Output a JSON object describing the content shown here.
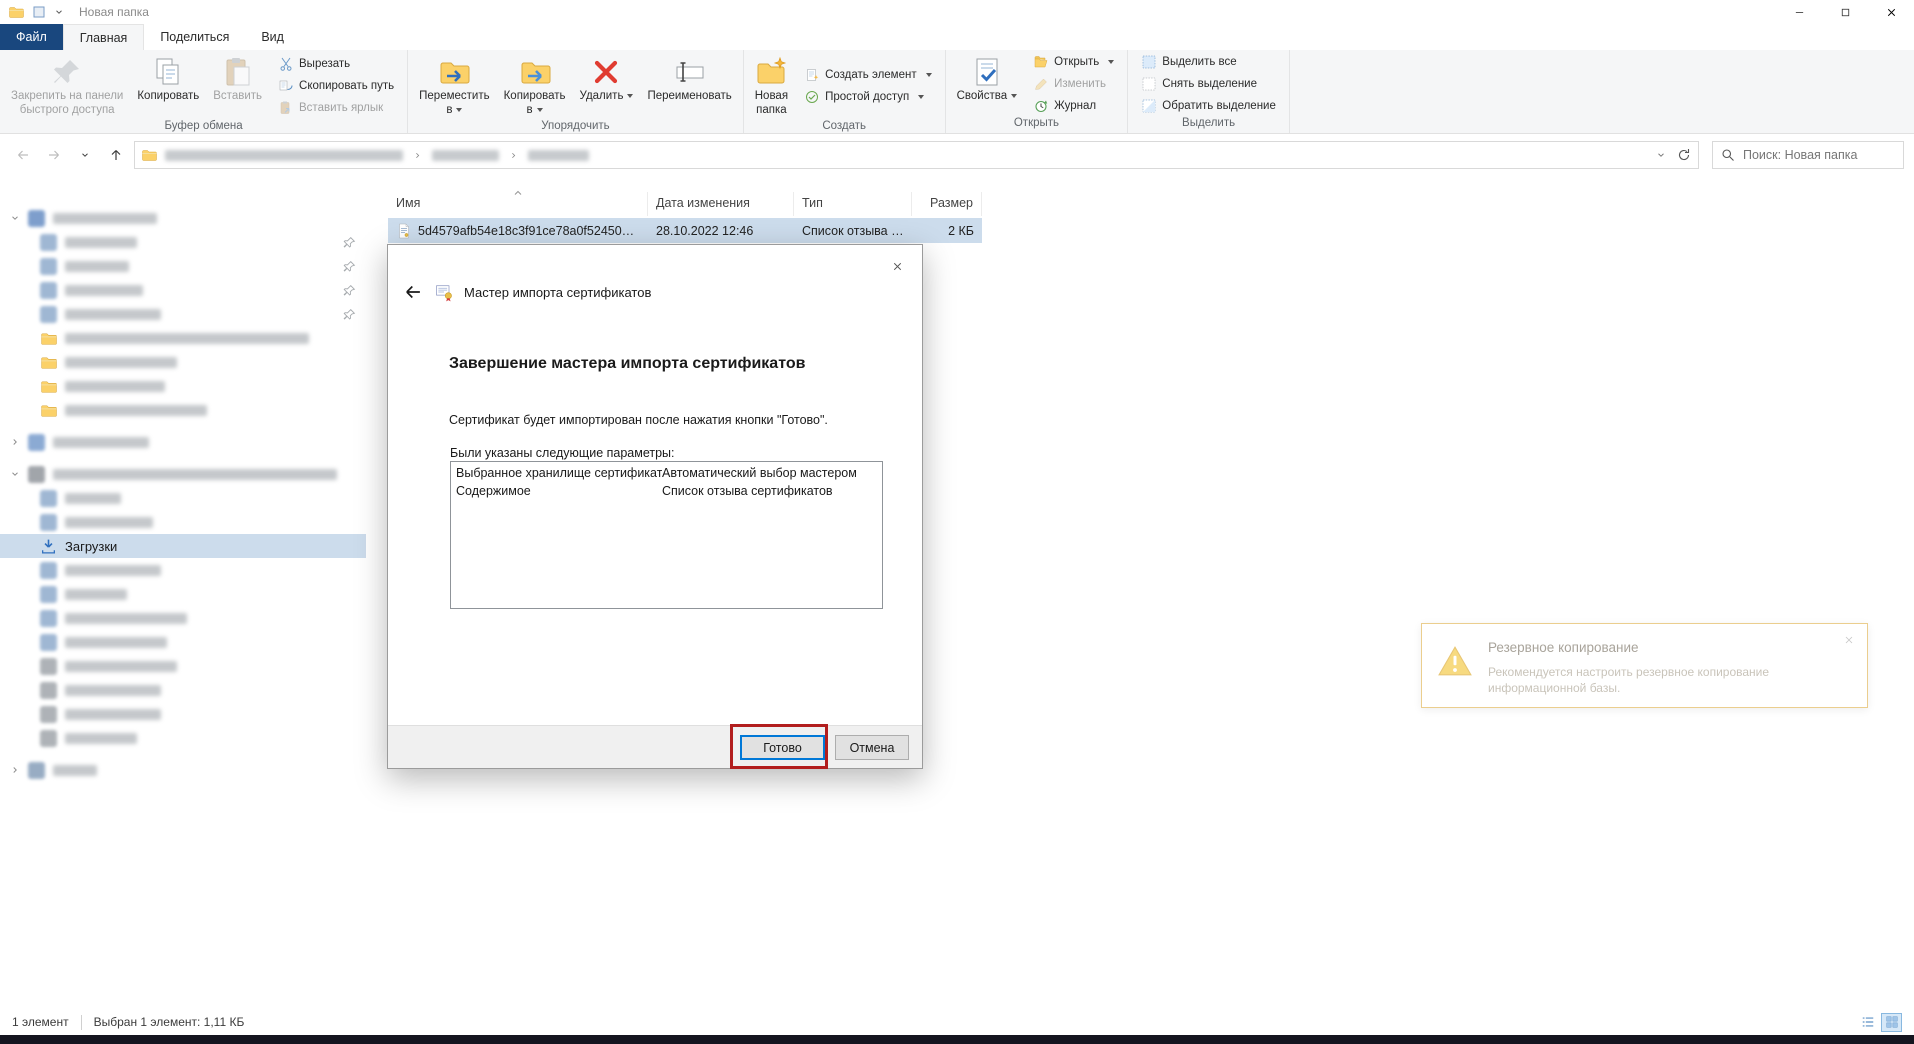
{
  "titlebar": {
    "title": "Новая папка"
  },
  "tabs": {
    "file_label": "Файл",
    "items": [
      {
        "label": "Главная",
        "selected": true
      },
      {
        "label": "Поделиться",
        "selected": false
      },
      {
        "label": "Вид",
        "selected": false
      }
    ]
  },
  "ribbon": {
    "groups": [
      {
        "label": "Буфер обмена",
        "buttons": [
          {
            "kind": "big",
            "icon": "pin-icon",
            "lines": [
              "Закрепить на панели",
              "быстрого доступа"
            ],
            "disabled": true
          },
          {
            "kind": "big",
            "icon": "copy-icon",
            "lines": [
              "Копировать"
            ],
            "disabled": false
          },
          {
            "kind": "big",
            "icon": "paste-icon",
            "lines": [
              "Вставить"
            ],
            "disabled": true
          },
          {
            "kind": "stack",
            "items": [
              {
                "icon": "cut-icon",
                "label": "Вырезать",
                "disabled": false
              },
              {
                "icon": "copy-path-icon",
                "label": "Скопировать путь",
                "disabled": false
              },
              {
                "icon": "paste-shortcut-icon",
                "label": "Вставить ярлык",
                "disabled": true
              }
            ]
          }
        ]
      },
      {
        "label": "Упорядочить",
        "buttons": [
          {
            "kind": "big",
            "icon": "move-to-icon",
            "lines": [
              "Переместить",
              "в"
            ],
            "dropdown": true
          },
          {
            "kind": "big",
            "icon": "copy-to-icon",
            "lines": [
              "Копировать",
              "в"
            ],
            "dropdown": true
          },
          {
            "kind": "big",
            "icon": "delete-icon",
            "lines": [
              "Удалить"
            ],
            "dropdown": true
          },
          {
            "kind": "big",
            "icon": "rename-icon",
            "lines": [
              "Переименовать"
            ]
          }
        ]
      },
      {
        "label": "Создать",
        "buttons": [
          {
            "kind": "big",
            "icon": "new-folder-icon",
            "lines": [
              "Новая",
              "папка"
            ]
          },
          {
            "kind": "stack",
            "items": [
              {
                "icon": "new-item-icon",
                "label": "Создать элемент",
                "dropdown": true
              },
              {
                "icon": "easy-access-icon",
                "label": "Простой доступ",
                "dropdown": true
              }
            ]
          }
        ]
      },
      {
        "label": "Открыть",
        "buttons": [
          {
            "kind": "big",
            "icon": "properties-icon",
            "lines": [
              "Свойства"
            ],
            "dropdown": true
          },
          {
            "kind": "stack",
            "items": [
              {
                "icon": "open-icon",
                "label": "Открыть",
                "dropdown": true
              },
              {
                "icon": "edit-icon",
                "label": "Изменить",
                "disabled": true
              },
              {
                "icon": "history-icon",
                "label": "Журнал"
              }
            ]
          }
        ]
      },
      {
        "label": "Выделить",
        "buttons": [
          {
            "kind": "stack",
            "items": [
              {
                "icon": "select-all-icon",
                "label": "Выделить все"
              },
              {
                "icon": "select-none-icon",
                "label": "Снять выделение"
              },
              {
                "icon": "invert-selection-icon",
                "label": "Обратить выделение"
              }
            ]
          }
        ]
      }
    ]
  },
  "navbar": {
    "search_placeholder": "Поиск: Новая папка"
  },
  "address": {
    "redacted_segments": [
      238,
      67,
      61
    ]
  },
  "sidebar": {
    "items": [
      {
        "icon": "blob",
        "color": "#5f87c0",
        "blur_width": 104,
        "indent": 0,
        "chevron": "down"
      },
      {
        "icon": "blob",
        "color": "#88a6c9",
        "blur_width": 72,
        "indent": 1,
        "pinned": true
      },
      {
        "icon": "blob",
        "color": "#88a6c9",
        "blur_width": 64,
        "indent": 1,
        "pinned": true
      },
      {
        "icon": "blob",
        "color": "#88a6c9",
        "blur_width": 78,
        "indent": 1,
        "pinned": true
      },
      {
        "icon": "blob",
        "color": "#88a6c9",
        "blur_width": 96,
        "indent": 1,
        "pinned": true
      },
      {
        "icon": "folder-icon",
        "blur_width": 244,
        "indent": 1
      },
      {
        "icon": "folder-icon",
        "blur_width": 112,
        "indent": 1
      },
      {
        "icon": "folder-icon",
        "blur_width": 100,
        "indent": 1
      },
      {
        "icon": "folder-icon",
        "blur_width": 142,
        "indent": 1
      },
      {
        "icon": "blob",
        "color": "#6f95c9",
        "blur_width": 96,
        "indent": 0,
        "chevron": "right",
        "gap_before": true
      },
      {
        "icon": "blob",
        "color": "#8a8f96",
        "blur_width": 284,
        "indent": 0,
        "chevron": "down",
        "gap_before": true
      },
      {
        "icon": "blob",
        "color": "#88a6c9",
        "blur_width": 56,
        "indent": 1
      },
      {
        "icon": "blob",
        "color": "#88a6c9",
        "blur_width": 88,
        "indent": 1
      },
      {
        "icon": "download-icon",
        "label": "Загрузки",
        "indent": 1,
        "selected": true
      },
      {
        "icon": "blob",
        "color": "#88a6c9",
        "blur_width": 96,
        "indent": 1
      },
      {
        "icon": "blob",
        "color": "#88a6c9",
        "blur_width": 62,
        "indent": 1
      },
      {
        "icon": "blob",
        "color": "#88a6c9",
        "blur_width": 122,
        "indent": 1
      },
      {
        "icon": "blob",
        "color": "#88a6c9",
        "blur_width": 102,
        "indent": 1
      },
      {
        "icon": "blob",
        "color": "#9aa0a6",
        "blur_width": 112,
        "indent": 1
      },
      {
        "icon": "blob",
        "color": "#9aa0a6",
        "blur_width": 96,
        "indent": 1
      },
      {
        "icon": "blob",
        "color": "#9aa0a6",
        "blur_width": 96,
        "indent": 1
      },
      {
        "icon": "blob",
        "color": "#9aa0a6",
        "blur_width": 72,
        "indent": 1
      },
      {
        "icon": "blob",
        "color": "#7f98b5",
        "blur_width": 44,
        "indent": 0,
        "chevron": "right",
        "gap_before": true
      }
    ]
  },
  "file_list": {
    "columns": [
      {
        "label": "Имя"
      },
      {
        "label": "Дата изменения"
      },
      {
        "label": "Тип"
      },
      {
        "label": "Размер"
      }
    ],
    "rows": [
      {
        "icon": "certificate-file-icon",
        "name": "5d4579afb54e18c3f91ce78a0f524504ca28...",
        "date": "28.10.2022 12:46",
        "type": "Список отзыва се...",
        "size": "2 КБ",
        "selected": true
      }
    ]
  },
  "dialog": {
    "title": "Мастер импорта сертификатов",
    "heading": "Завершение мастера импорта сертификатов",
    "body": "Сертификат будет импортирован после нажатия кнопки \"Готово\".",
    "params_label": "Были указаны следующие параметры:",
    "params": [
      {
        "key": "Выбранное хранилище сертификатов",
        "value": "Автоматический выбор мастером"
      },
      {
        "key": "Содержимое",
        "value": "Список отзыва сертификатов"
      }
    ],
    "finish_label": "Готово",
    "cancel_label": "Отмена"
  },
  "toast": {
    "title": "Резервное копирование",
    "body": "Рекомендуется настроить резервное копирование информационной базы."
  },
  "statusbar": {
    "items_count": "1 элемент",
    "selection_info": "Выбран 1 элемент: 1,11 КБ"
  },
  "annotation": {
    "color": "#b21e1e"
  }
}
